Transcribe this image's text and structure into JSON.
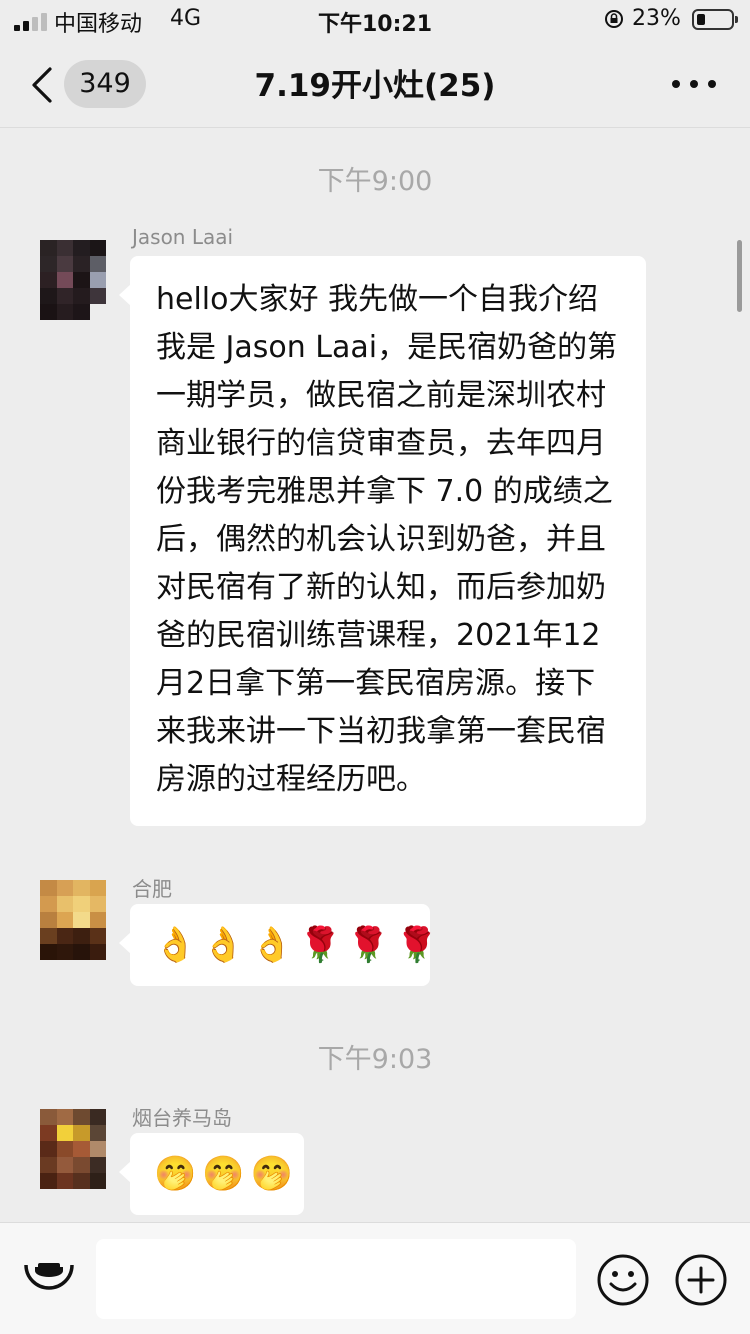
{
  "status_bar": {
    "carrier": "中国移动",
    "network": "4G",
    "time": "下午10:21",
    "battery": "23%",
    "battery_level": 0.23
  },
  "nav": {
    "unread_count": "349",
    "title": "7.19开小灶(25)"
  },
  "messages": [
    {
      "type": "timestamp",
      "text": "下午9:00"
    },
    {
      "type": "message",
      "sender": "Jason Laai",
      "text": "hello大家好 我先做一个自我介绍 我是 Jason Laai，是民宿奶爸的第一期学员，做民宿之前是深圳农村商业银行的信贷审查员，去年四月份我考完雅思并拿下 7.0 的成绩之后，偶然的机会认识到奶爸，并且对民宿有了新的认知，而后参加奶爸的民宿训练营课程，2021年12月2日拿下第一套民宿房源。接下来我来讲一下当初我拿第一套民宿房源的过程经历吧。"
    },
    {
      "type": "message",
      "sender": "合肥",
      "emojis": [
        "👌",
        "👌",
        "👌",
        "🌹",
        "🌹",
        "🌹"
      ]
    },
    {
      "type": "timestamp",
      "text": "下午9:03"
    },
    {
      "type": "message",
      "sender": "烟台养马岛",
      "emojis": [
        "🤭",
        "🤭",
        "🤭"
      ]
    }
  ],
  "input_bar": {
    "voice_icon": "voice-icon",
    "emoji_icon": "emoji-smile-icon",
    "more_icon": "plus-circle-icon"
  },
  "colors": {
    "background": "#ededed",
    "bubble": "#ffffff",
    "timestamp": "#a8a8a8",
    "sender": "#8c8c8c"
  }
}
